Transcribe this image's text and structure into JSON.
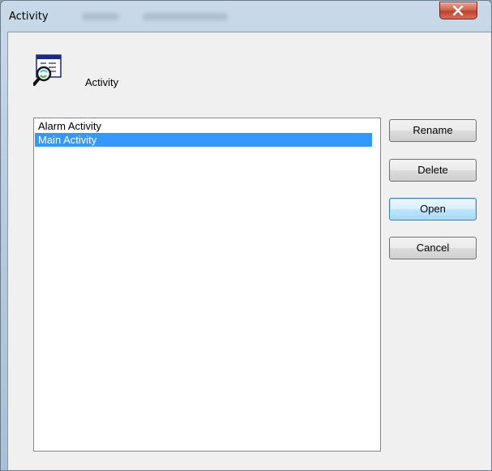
{
  "window": {
    "title": "Activity",
    "close_glyph": "✕"
  },
  "header": {
    "label": "Activity",
    "icon": "activity-window-magnifier-icon"
  },
  "list": {
    "items": [
      {
        "label": "Alarm Activity",
        "selected": false
      },
      {
        "label": "Main Activity",
        "selected": true
      }
    ]
  },
  "buttons": {
    "rename": "Rename",
    "delete": "Delete",
    "open": "Open",
    "cancel": "Cancel"
  },
  "colors": {
    "selection": "#3399ff",
    "close_button": "#c7503a"
  }
}
